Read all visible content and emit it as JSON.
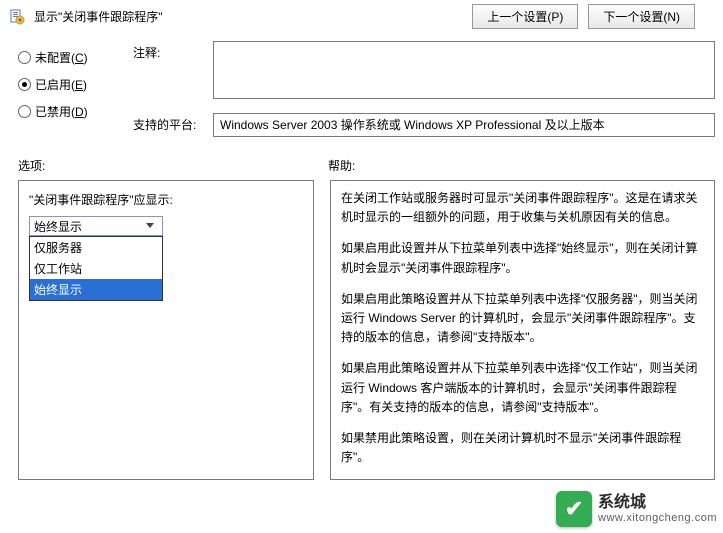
{
  "header": {
    "icon_name": "policy-icon",
    "title": "显示\"关闭事件跟踪程序\"",
    "prev_button": "上一个设置(P)",
    "next_button": "下一个设置(N)"
  },
  "radios": {
    "not_configured": "未配置(C)",
    "enabled": "已启用(E)",
    "disabled": "已禁用(D)",
    "selected": "enabled"
  },
  "fields": {
    "comment_label": "注释:",
    "comment_value": "",
    "platform_label": "支持的平台:",
    "platform_value": "Windows Server 2003 操作系统或 Windows XP Professional 及以上版本"
  },
  "section": {
    "options_label": "选项:",
    "help_label": "帮助:"
  },
  "options": {
    "dropdown_label": "\"关闭事件跟踪程序\"应显示:",
    "dropdown_value": "始终显示",
    "dropdown_items": [
      "仅服务器",
      "仅工作站",
      "始终显示"
    ],
    "dropdown_selected_index": 2
  },
  "help": {
    "p1": "在关闭工作站或服务器时可显示\"关闭事件跟踪程序\"。这是在请求关机时显示的一组额外的问题，用于收集与关机原因有关的信息。",
    "p2": "如果启用此设置并从下拉菜单列表中选择\"始终显示\"，则在关闭计算机时会显示\"关闭事件跟踪程序\"。",
    "p3": "如果启用此策略设置并从下拉菜单列表中选择\"仅服务器\"，则当关闭运行 Windows Server 的计算机时，会显示\"关闭事件跟踪程序\"。支持的版本的信息，请参阅\"支持版本\"。",
    "p4": "如果启用此策略设置并从下拉菜单列表中选择\"仅工作站\"，则当关闭运行 Windows 客户端版本的计算机时，会显示\"关闭事件跟踪程序\"。有关支持的版本的信息，请参阅\"支持版本\"。",
    "p5": "如果禁用此策略设置，则在关闭计算机时不显示\"关闭事件跟踪程序\"。"
  },
  "watermark": {
    "brand": "系统城",
    "url": "www.xitongcheng.com"
  }
}
